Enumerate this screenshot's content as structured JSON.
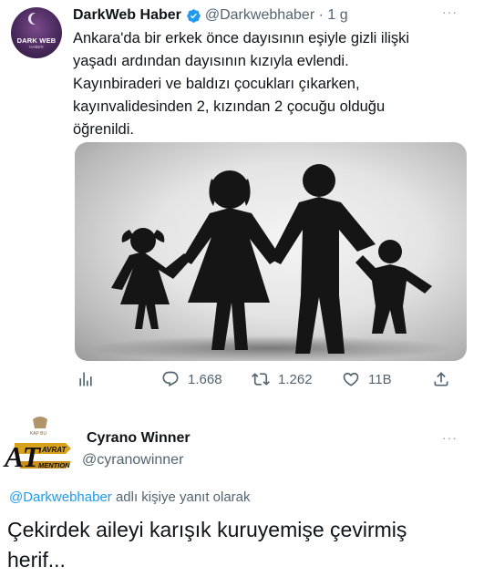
{
  "tweet": {
    "author_name": "DarkWeb Haber",
    "handle": "@Darkwebhaber",
    "separator": "·",
    "time": "1 g",
    "more": "···",
    "text_lines": [
      "Ankara'da bir erkek önce dayısının eşiyle gizli ilişki",
      "yaşadı ardından dayısının kızıyla evlendi.",
      "Kayınbiraderi ve baldızı çocukları çıkarken,",
      "kayınvalidesinden 2, kızından 2 çocuğu olduğu",
      "öğrenildi."
    ],
    "avatar_text_line1": "DARK WEB",
    "avatar_text_line2": "HABER",
    "counts": {
      "replies": "1.668",
      "retweets": "1.262",
      "likes": "11B"
    },
    "colors": {
      "verified": "#1d9bf0",
      "muted": "#536471"
    }
  },
  "reply": {
    "author_name": "Cyrano Winner",
    "handle": "@cyranowinner",
    "more": "···",
    "replying_to_handle": "@Darkwebhaber",
    "replying_to_suffix": " adlı kişiye yanıt olarak",
    "text_lines": [
      "Çekirdek aileyi karışık kuruyemişe çevirmiş",
      "herif..."
    ],
    "avatar_logo_big": "AT",
    "avatar_logo_top": "AVRAT",
    "avatar_logo_bottom": "MENTION",
    "avatar_logo_small": "KAP BU"
  }
}
